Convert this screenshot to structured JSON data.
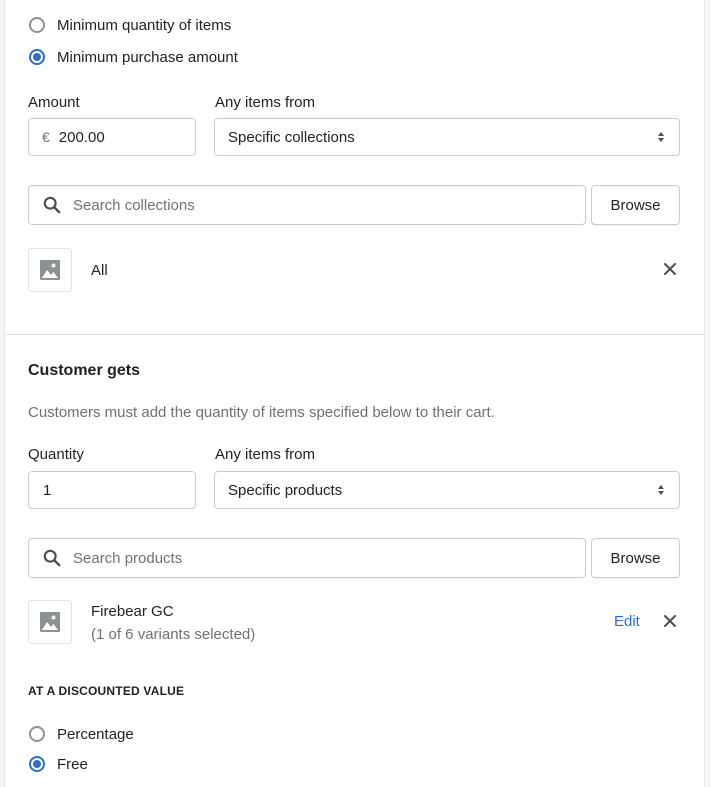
{
  "requirements": {
    "options": [
      {
        "label": "Minimum quantity of items",
        "checked": false
      },
      {
        "label": "Minimum purchase amount",
        "checked": true
      }
    ],
    "amount_label": "Amount",
    "amount_prefix": "€",
    "amount_value": "200.00",
    "items_from_label": "Any items from",
    "items_from_value": "Specific collections",
    "search_placeholder": "Search collections",
    "browse_label": "Browse",
    "selected_item": {
      "title": "All",
      "icon": "image-icon",
      "remove_icon": "close-icon"
    }
  },
  "customer_gets": {
    "heading": "Customer gets",
    "description": "Customers must add the quantity of items specified below to their cart.",
    "quantity_label": "Quantity",
    "quantity_value": "1",
    "items_from_label": "Any items from",
    "items_from_value": "Specific products",
    "search_placeholder": "Search products",
    "browse_label": "Browse",
    "selected_item": {
      "title": "Firebear GC",
      "subtitle": "(1 of 6 variants selected)",
      "edit_label": "Edit",
      "icon": "image-icon",
      "remove_icon": "close-icon"
    },
    "discount_heading": "AT A DISCOUNTED VALUE",
    "discount_options": [
      {
        "label": "Percentage",
        "checked": false
      },
      {
        "label": "Free",
        "checked": true
      }
    ]
  },
  "colors": {
    "accent": "#2c6ecb",
    "border": "#c4cdd5",
    "text": "#202223",
    "subdued": "#6d7175"
  }
}
